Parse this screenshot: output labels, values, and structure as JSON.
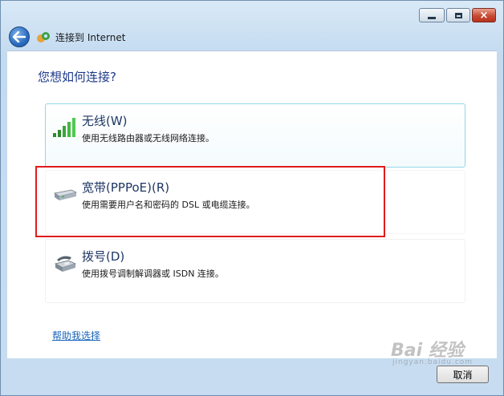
{
  "window": {
    "title": "连接到 Internet",
    "controls": {
      "minimize": "minimize",
      "maximize": "maximize",
      "close": "×"
    }
  },
  "main": {
    "question": "您想如何连接?",
    "options": [
      {
        "title": "无线(W)",
        "description": "使用无线路由器或无线网络连接。",
        "icon": "wireless-signal-icon"
      },
      {
        "title": "宽带(PPPoE)(R)",
        "description": "使用需要用户名和密码的 DSL 或电缆连接。",
        "icon": "broadband-modem-icon"
      },
      {
        "title": "拨号(D)",
        "description": "使用拨号调制解调器或 ISDN 连接。",
        "icon": "dialup-phone-icon"
      }
    ],
    "help_link": "帮助我选择"
  },
  "footer": {
    "cancel_label": "取消"
  },
  "watermark": {
    "main": "Bai 经验",
    "sub": "jingyan.baidu.com"
  },
  "colors": {
    "highlight": "#e01b1b",
    "link": "#1763b8",
    "question": "#1e3a8a"
  }
}
